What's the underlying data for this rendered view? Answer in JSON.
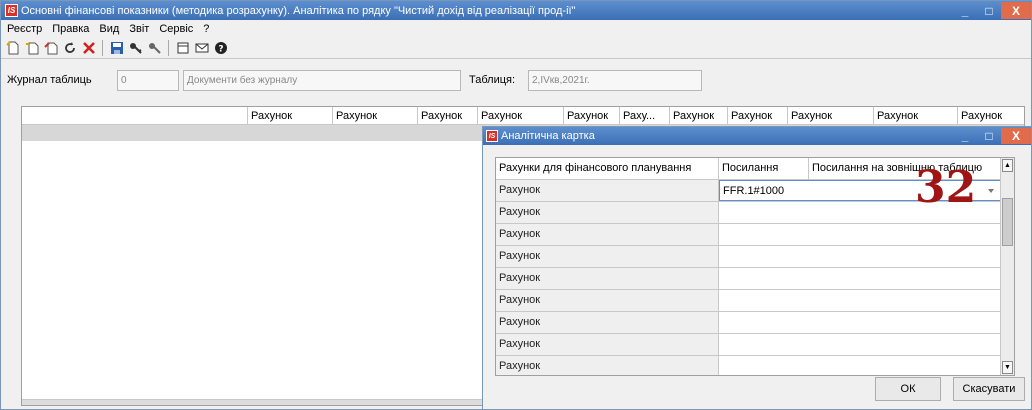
{
  "window": {
    "title": "Основні фінансові показники (методика розрахунку). Аналітика по рядку \"Чистий дохід від реалізації прод-ії\"",
    "logo": "IS",
    "controls": [
      "_",
      "□",
      "X"
    ]
  },
  "menu": [
    "Реєстр",
    "Правка",
    "Вид",
    "Звіт",
    "Сервіс",
    "?"
  ],
  "toolbar_icons": [
    "new-doc-icon",
    "copy-doc-icon",
    "edit-doc-icon",
    "refresh-icon",
    "delete-icon",
    "save-icon",
    "key-icon",
    "key-gray-icon",
    "window-icon",
    "mail-icon",
    "help-icon"
  ],
  "fields": {
    "journal_label": "Журнал таблиць",
    "journal_value": "0",
    "journal_name": "Документи без журналу",
    "table_label": "Таблиця:",
    "table_value": "2,IVкв,2021г."
  },
  "grid": {
    "columns": [
      "",
      "Рахунок",
      "Рахунок",
      "Рахунок",
      "Рахунок",
      "Рахунок",
      "Раху...",
      "Рахунок",
      "Рахунок",
      "Рахунок",
      "Рахунок",
      "Рахунок"
    ]
  },
  "dialog": {
    "title": "Аналітична картка",
    "logo": "IS",
    "controls": [
      "_",
      "□",
      "X"
    ],
    "header": [
      "Рахунки для фінансового планування",
      "Посилання",
      "Посилання на зовнішню таблицю"
    ],
    "rows": [
      {
        "label": "Рахунок",
        "value": "FFR.1#1000"
      },
      {
        "label": "Рахунок",
        "value": ""
      },
      {
        "label": "Рахунок",
        "value": ""
      },
      {
        "label": "Рахунок",
        "value": ""
      },
      {
        "label": "Рахунок",
        "value": ""
      },
      {
        "label": "Рахунок",
        "value": ""
      },
      {
        "label": "Рахунок",
        "value": ""
      },
      {
        "label": "Рахунок",
        "value": ""
      },
      {
        "label": "Рахунок",
        "value": ""
      }
    ],
    "ok_label": "ОК",
    "cancel_label": "Скасувати"
  },
  "annotation": "32",
  "colors": {
    "titlebar": "#4a7fc4",
    "close_button": "#e06c4b",
    "annotation": "#a01414",
    "logo": "#d93026"
  }
}
